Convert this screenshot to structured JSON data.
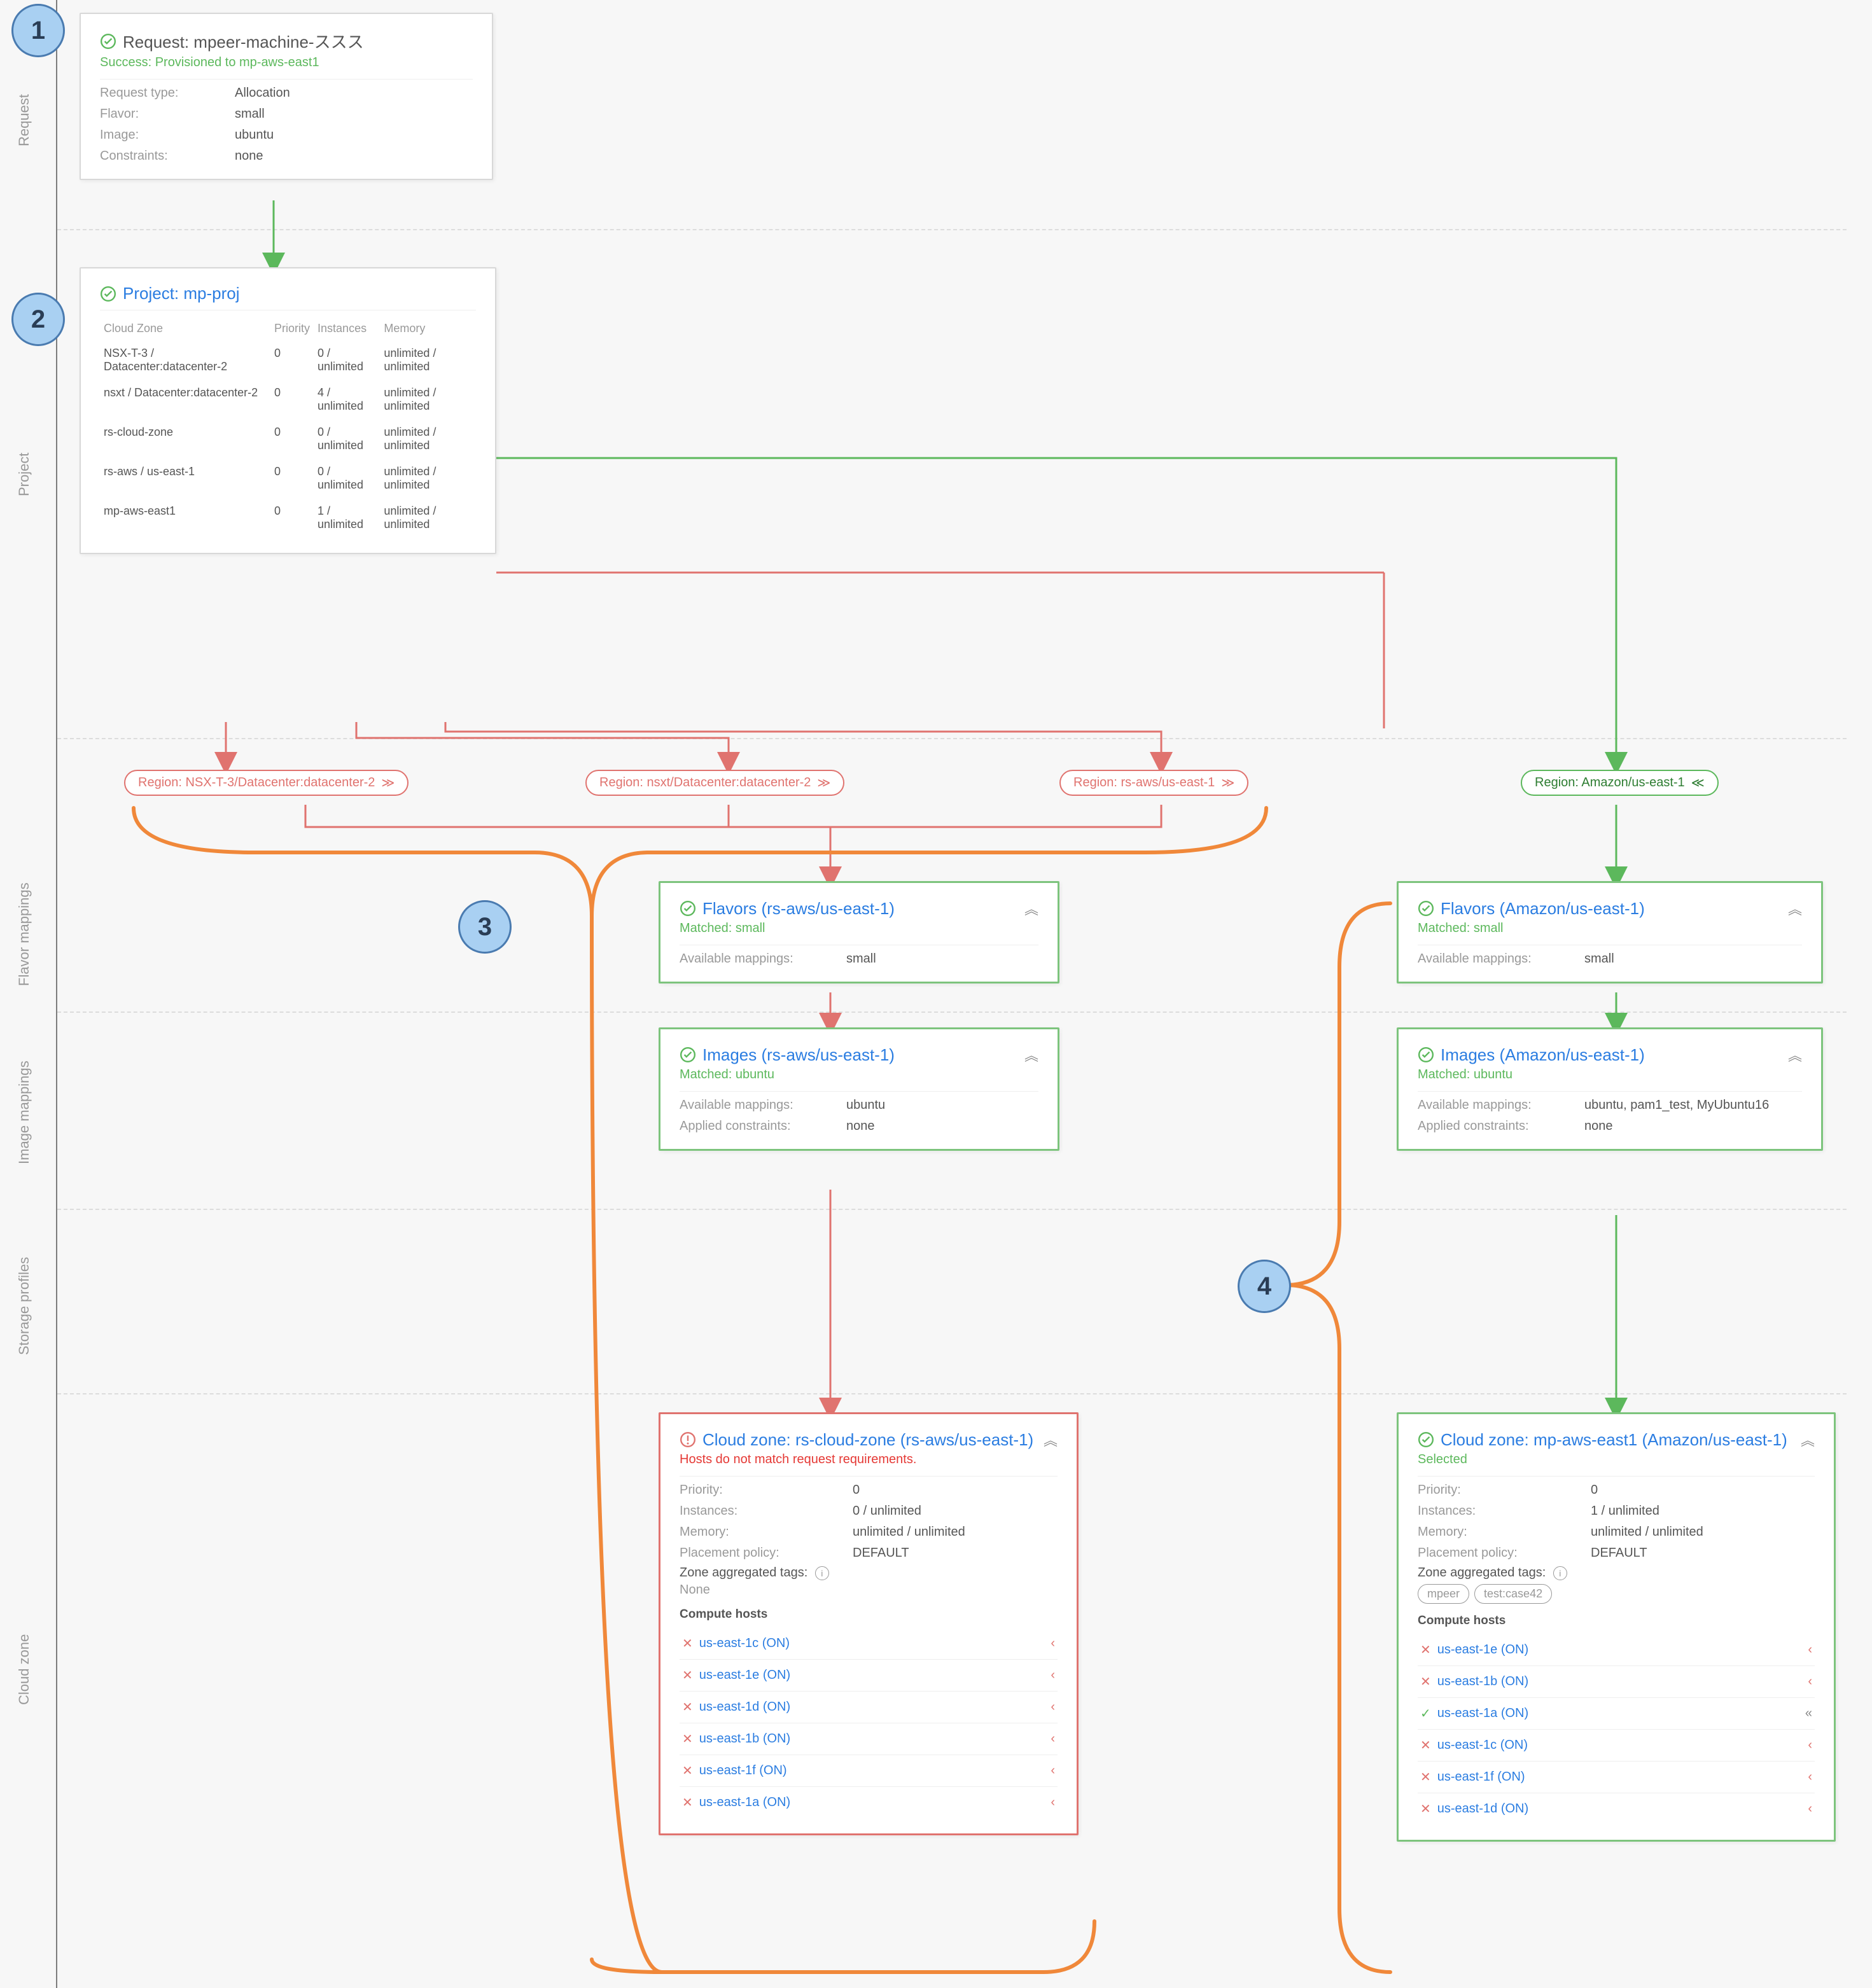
{
  "sections": {
    "request": "Request",
    "project": "Project",
    "flavor": "Flavor mappings",
    "image": "Image mappings",
    "storage": "Storage profiles",
    "cloudzone": "Cloud zone"
  },
  "circles": {
    "one": "1",
    "two": "2",
    "three": "3",
    "four": "4"
  },
  "request": {
    "title": "Request: mpeer-machine-ススス",
    "status": "Success: Provisioned to mp-aws-east1",
    "rows": {
      "type_k": "Request type:",
      "type_v": "Allocation",
      "flavor_k": "Flavor:",
      "flavor_v": "small",
      "image_k": "Image:",
      "image_v": "ubuntu",
      "constraints_k": "Constraints:",
      "constraints_v": "none"
    }
  },
  "project": {
    "title": "Project: mp-proj",
    "headers": {
      "cz": "Cloud Zone",
      "prio": "Priority",
      "inst": "Instances",
      "mem": "Memory"
    },
    "rows": [
      {
        "cz": "NSX-T-3 / Datacenter:datacenter-2",
        "prio": "0",
        "inst": "0 / unlimited",
        "mem": "unlimited / unlimited"
      },
      {
        "cz": "nsxt / Datacenter:datacenter-2",
        "prio": "0",
        "inst": "4 / unlimited",
        "mem": "unlimited / unlimited"
      },
      {
        "cz": "rs-cloud-zone",
        "prio": "0",
        "inst": "0 / unlimited",
        "mem": "unlimited / unlimited"
      },
      {
        "cz": "rs-aws / us-east-1",
        "prio": "0",
        "inst": "0 / unlimited",
        "mem": "unlimited / unlimited"
      },
      {
        "cz": "mp-aws-east1",
        "prio": "0",
        "inst": "1 / unlimited",
        "mem": "unlimited / unlimited"
      }
    ]
  },
  "regions": {
    "r1": "Region: NSX-T-3/Datacenter:datacenter-2",
    "r2": "Region: nsxt/Datacenter:datacenter-2",
    "r3": "Region: rs-aws/us-east-1",
    "r4": "Region: Amazon/us-east-1"
  },
  "flavorsLeft": {
    "title": "Flavors (rs-aws/us-east-1)",
    "matched": "Matched: small",
    "avail_k": "Available mappings:",
    "avail_v": "small"
  },
  "flavorsRight": {
    "title": "Flavors (Amazon/us-east-1)",
    "matched": "Matched: small",
    "avail_k": "Available mappings:",
    "avail_v": "small"
  },
  "imagesLeft": {
    "title": "Images (rs-aws/us-east-1)",
    "matched": "Matched: ubuntu",
    "avail_k": "Available mappings:",
    "avail_v": "ubuntu",
    "appl_k": "Applied constraints:",
    "appl_v": "none"
  },
  "imagesRight": {
    "title": "Images (Amazon/us-east-1)",
    "matched": "Matched: ubuntu",
    "avail_k": "Available mappings:",
    "avail_v": "ubuntu, pam1_test, MyUbuntu16",
    "appl_k": "Applied constraints:",
    "appl_v": "none"
  },
  "czLeft": {
    "title": "Cloud zone: rs-cloud-zone (rs-aws/us-east-1)",
    "sub": "Hosts do not match request requirements.",
    "kv": {
      "prio_k": "Priority:",
      "prio_v": "0",
      "inst_k": "Instances:",
      "inst_v": "0 / unlimited",
      "mem_k": "Memory:",
      "mem_v": "unlimited / unlimited",
      "pol_k": "Placement policy:",
      "pol_v": "DEFAULT",
      "tags_k": "Zone aggregated tags:",
      "tags_v": "None"
    },
    "hosts_title": "Compute hosts",
    "hosts": [
      "us-east-1c (ON)",
      "us-east-1e (ON)",
      "us-east-1d (ON)",
      "us-east-1b (ON)",
      "us-east-1f (ON)",
      "us-east-1a (ON)"
    ]
  },
  "czRight": {
    "title": "Cloud zone: mp-aws-east1 (Amazon/us-east-1)",
    "sub": "Selected",
    "kv": {
      "prio_k": "Priority:",
      "prio_v": "0",
      "inst_k": "Instances:",
      "inst_v": "1 / unlimited",
      "mem_k": "Memory:",
      "mem_v": "unlimited / unlimited",
      "pol_k": "Placement policy:",
      "pol_v": "DEFAULT",
      "tags_k": "Zone aggregated tags:"
    },
    "tags": [
      "mpeer",
      "test:case42"
    ],
    "hosts_title": "Compute hosts",
    "hosts": [
      {
        "name": "us-east-1e (ON)",
        "ok": false
      },
      {
        "name": "us-east-1b (ON)",
        "ok": false
      },
      {
        "name": "us-east-1a (ON)",
        "ok": true
      },
      {
        "name": "us-east-1c (ON)",
        "ok": false
      },
      {
        "name": "us-east-1f (ON)",
        "ok": false
      },
      {
        "name": "us-east-1d (ON)",
        "ok": false
      }
    ]
  },
  "chart_data": {
    "type": "table",
    "title": "Project: mp-proj — Cloud Zone allocation",
    "columns": [
      "Cloud Zone",
      "Priority",
      "Instances",
      "Memory"
    ],
    "rows": [
      [
        "NSX-T-3 / Datacenter:datacenter-2",
        "0",
        "0 / unlimited",
        "unlimited / unlimited"
      ],
      [
        "nsxt / Datacenter:datacenter-2",
        "0",
        "4 / unlimited",
        "unlimited / unlimited"
      ],
      [
        "rs-cloud-zone",
        "0",
        "0 / unlimited",
        "unlimited / unlimited"
      ],
      [
        "rs-aws / us-east-1",
        "0",
        "0 / unlimited",
        "unlimited / unlimited"
      ],
      [
        "mp-aws-east1",
        "0",
        "1 / unlimited",
        "unlimited / unlimited"
      ]
    ]
  }
}
